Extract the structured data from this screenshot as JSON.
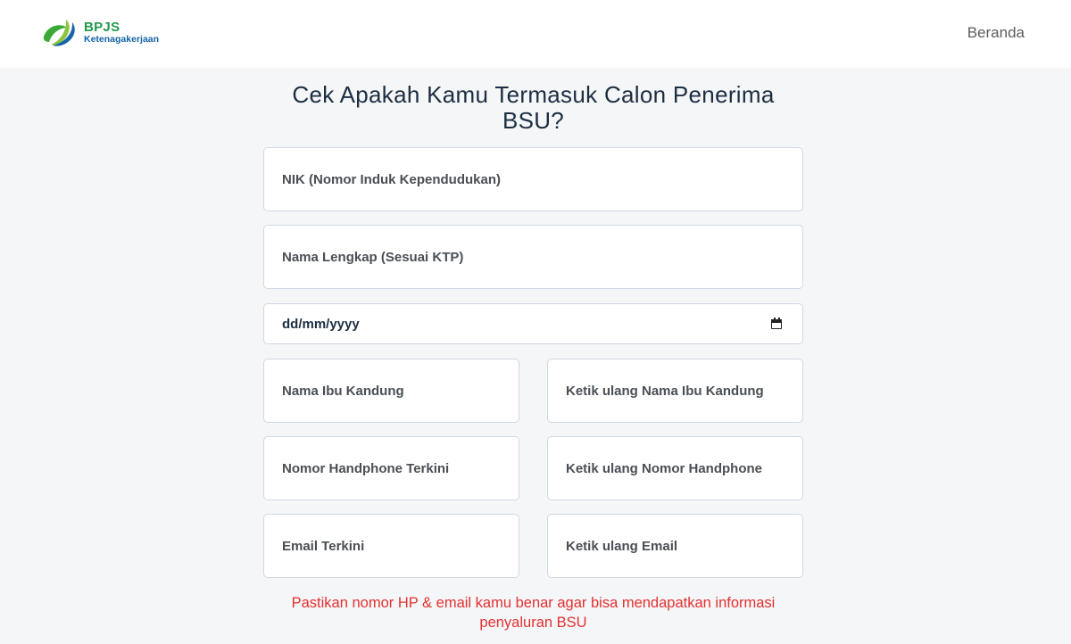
{
  "header": {
    "logo": {
      "brand": "BPJS",
      "sub": "Ketenagakerjaan"
    },
    "nav_home": "Beranda"
  },
  "form": {
    "title": "Cek Apakah Kamu Termasuk Calon Penerima BSU?",
    "nik_placeholder": "NIK (Nomor Induk Kependudukan)",
    "name_placeholder": "Nama Lengkap (Sesuai KTP)",
    "date_value": "dd/mm/yyyy",
    "mother_placeholder": "Nama Ibu Kandung",
    "mother_confirm_placeholder": "Ketik ulang Nama Ibu Kandung",
    "phone_placeholder": "Nomor Handphone Terkini",
    "phone_confirm_placeholder": "Ketik ulang Nomor Handphone",
    "email_placeholder": "Email Terkini",
    "email_confirm_placeholder": "Ketik ulang Email",
    "notice": "Pastikan nomor HP & email kamu benar agar bisa mendapatkan informasi penyaluran BSU"
  },
  "colors": {
    "brand_green": "#1f9a48",
    "brand_blue": "#1565a8",
    "notice_red": "#e53030",
    "background": "#f5f6f8"
  },
  "icons": [
    "bpjs-logo-icon",
    "calendar-icon"
  ]
}
